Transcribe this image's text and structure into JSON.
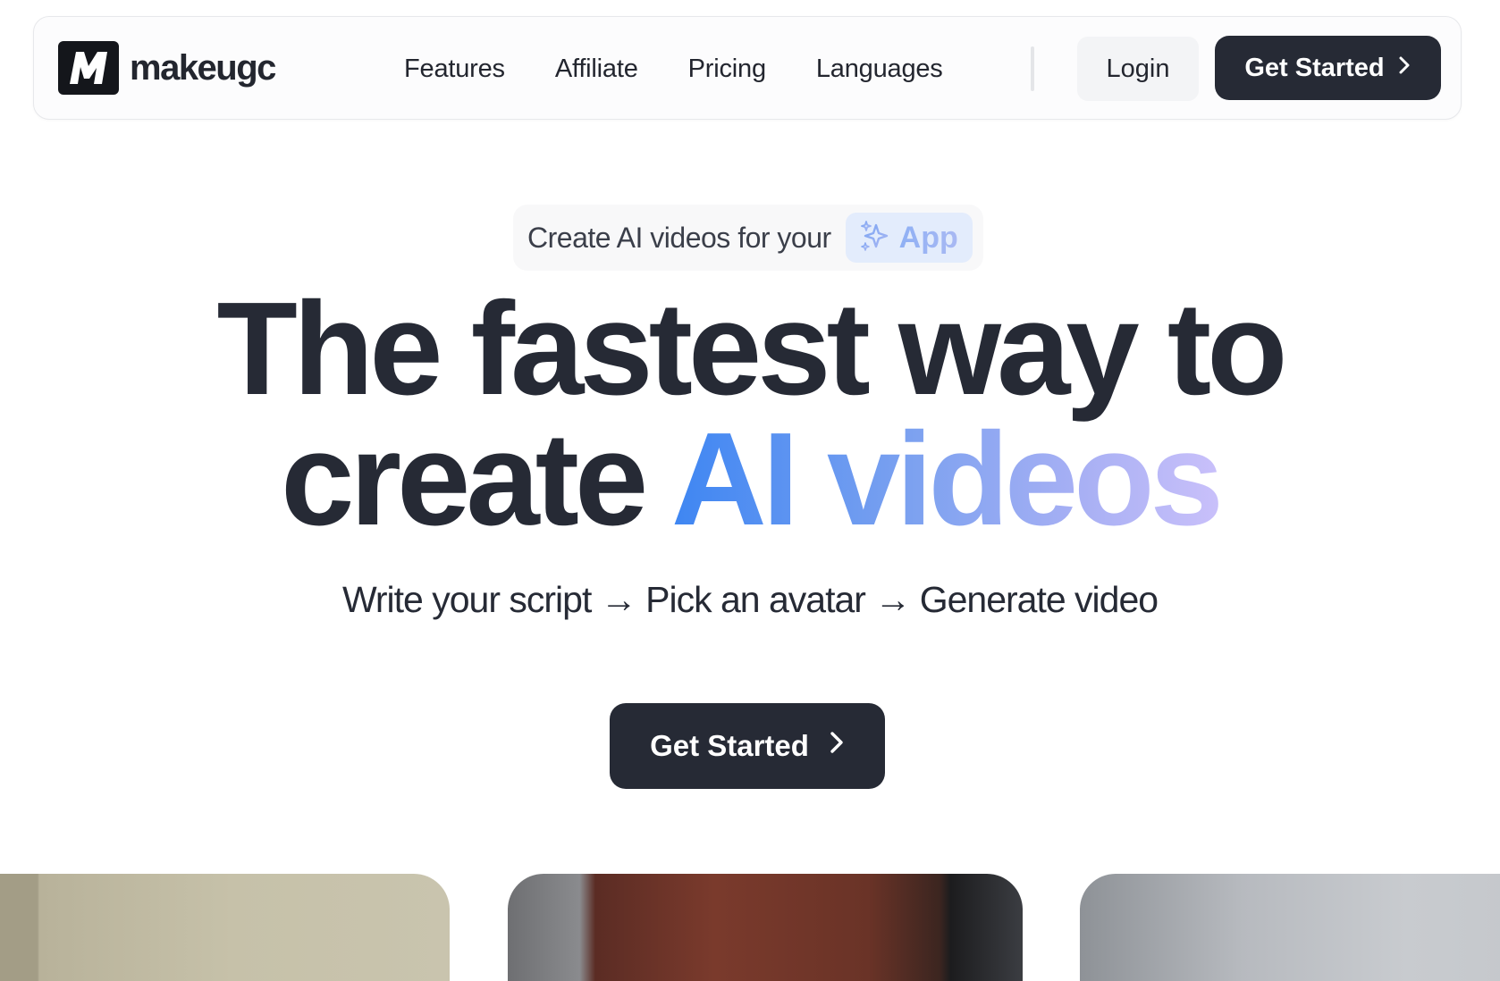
{
  "brand": {
    "name": "makeugc",
    "logo_icon": "M-logo-icon"
  },
  "nav": {
    "links": [
      "Features",
      "Affiliate",
      "Pricing",
      "Languages"
    ],
    "login_label": "Login",
    "cta_label": "Get Started"
  },
  "hero": {
    "pill_text": "Create AI videos for your",
    "pill_chip": "App",
    "headline_line1": "The fastest way to",
    "headline_line2_plain": "create",
    "headline_line2_accent": "AI videos",
    "subheadline": "Write your script → Pick an avatar → Generate video",
    "cta_label": "Get Started"
  },
  "colors": {
    "primary_dark": "#262a35",
    "accent_gradient_start": "#3e86f2",
    "accent_gradient_end": "#c9c0fa",
    "chip_background": "#e3ecfc"
  }
}
